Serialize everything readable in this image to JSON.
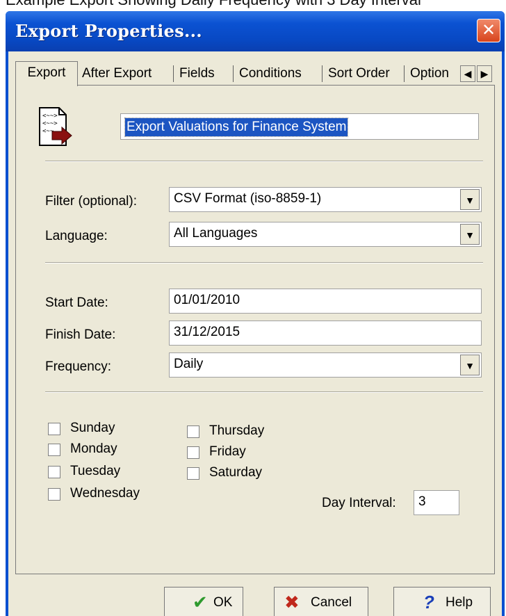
{
  "top_strip_text": "Example Export Showing Daily Frequency with 3 Day Interval",
  "window": {
    "title": "Export Properties...",
    "close_label": "✕"
  },
  "tabs": [
    {
      "label": "Export",
      "active": true
    },
    {
      "label": "After Export"
    },
    {
      "label": "Fields"
    },
    {
      "label": "Conditions"
    },
    {
      "label": "Sort Order"
    },
    {
      "label": "Option"
    }
  ],
  "tab_scroll": {
    "left": "◀",
    "right": "▶"
  },
  "export_name": "Export Valuations for Finance System",
  "filter": {
    "label": "Filter (optional):",
    "value": "CSV Format (iso-8859-1)"
  },
  "language": {
    "label": "Language:",
    "value": "All Languages"
  },
  "start_date": {
    "label": "Start Date:",
    "value": "01/01/2010"
  },
  "finish_date": {
    "label": "Finish Date:",
    "value": "31/12/2015"
  },
  "frequency": {
    "label": "Frequency:",
    "value": "Daily"
  },
  "combo_arrow": "▼",
  "days": {
    "col1": [
      "Sunday",
      "Monday",
      "Tuesday",
      "Wednesday"
    ],
    "col2": [
      "Thursday",
      "Friday",
      "Saturday"
    ]
  },
  "day_interval": {
    "label": "Day Interval:",
    "value": "3"
  },
  "buttons": {
    "ok": "OK",
    "cancel": "Cancel",
    "help": "Help",
    "ok_glyph": "✔",
    "cancel_glyph": "✖",
    "help_glyph": "?"
  },
  "colors": {
    "title_bar": "#0b52d2",
    "dialog_bg": "#ece9d8",
    "selection": "#1c55c2",
    "ok_check": "#2e9a2e",
    "cancel_x": "#c0281c",
    "help_q": "#1a3fb8",
    "close_button": "#d8441c"
  }
}
